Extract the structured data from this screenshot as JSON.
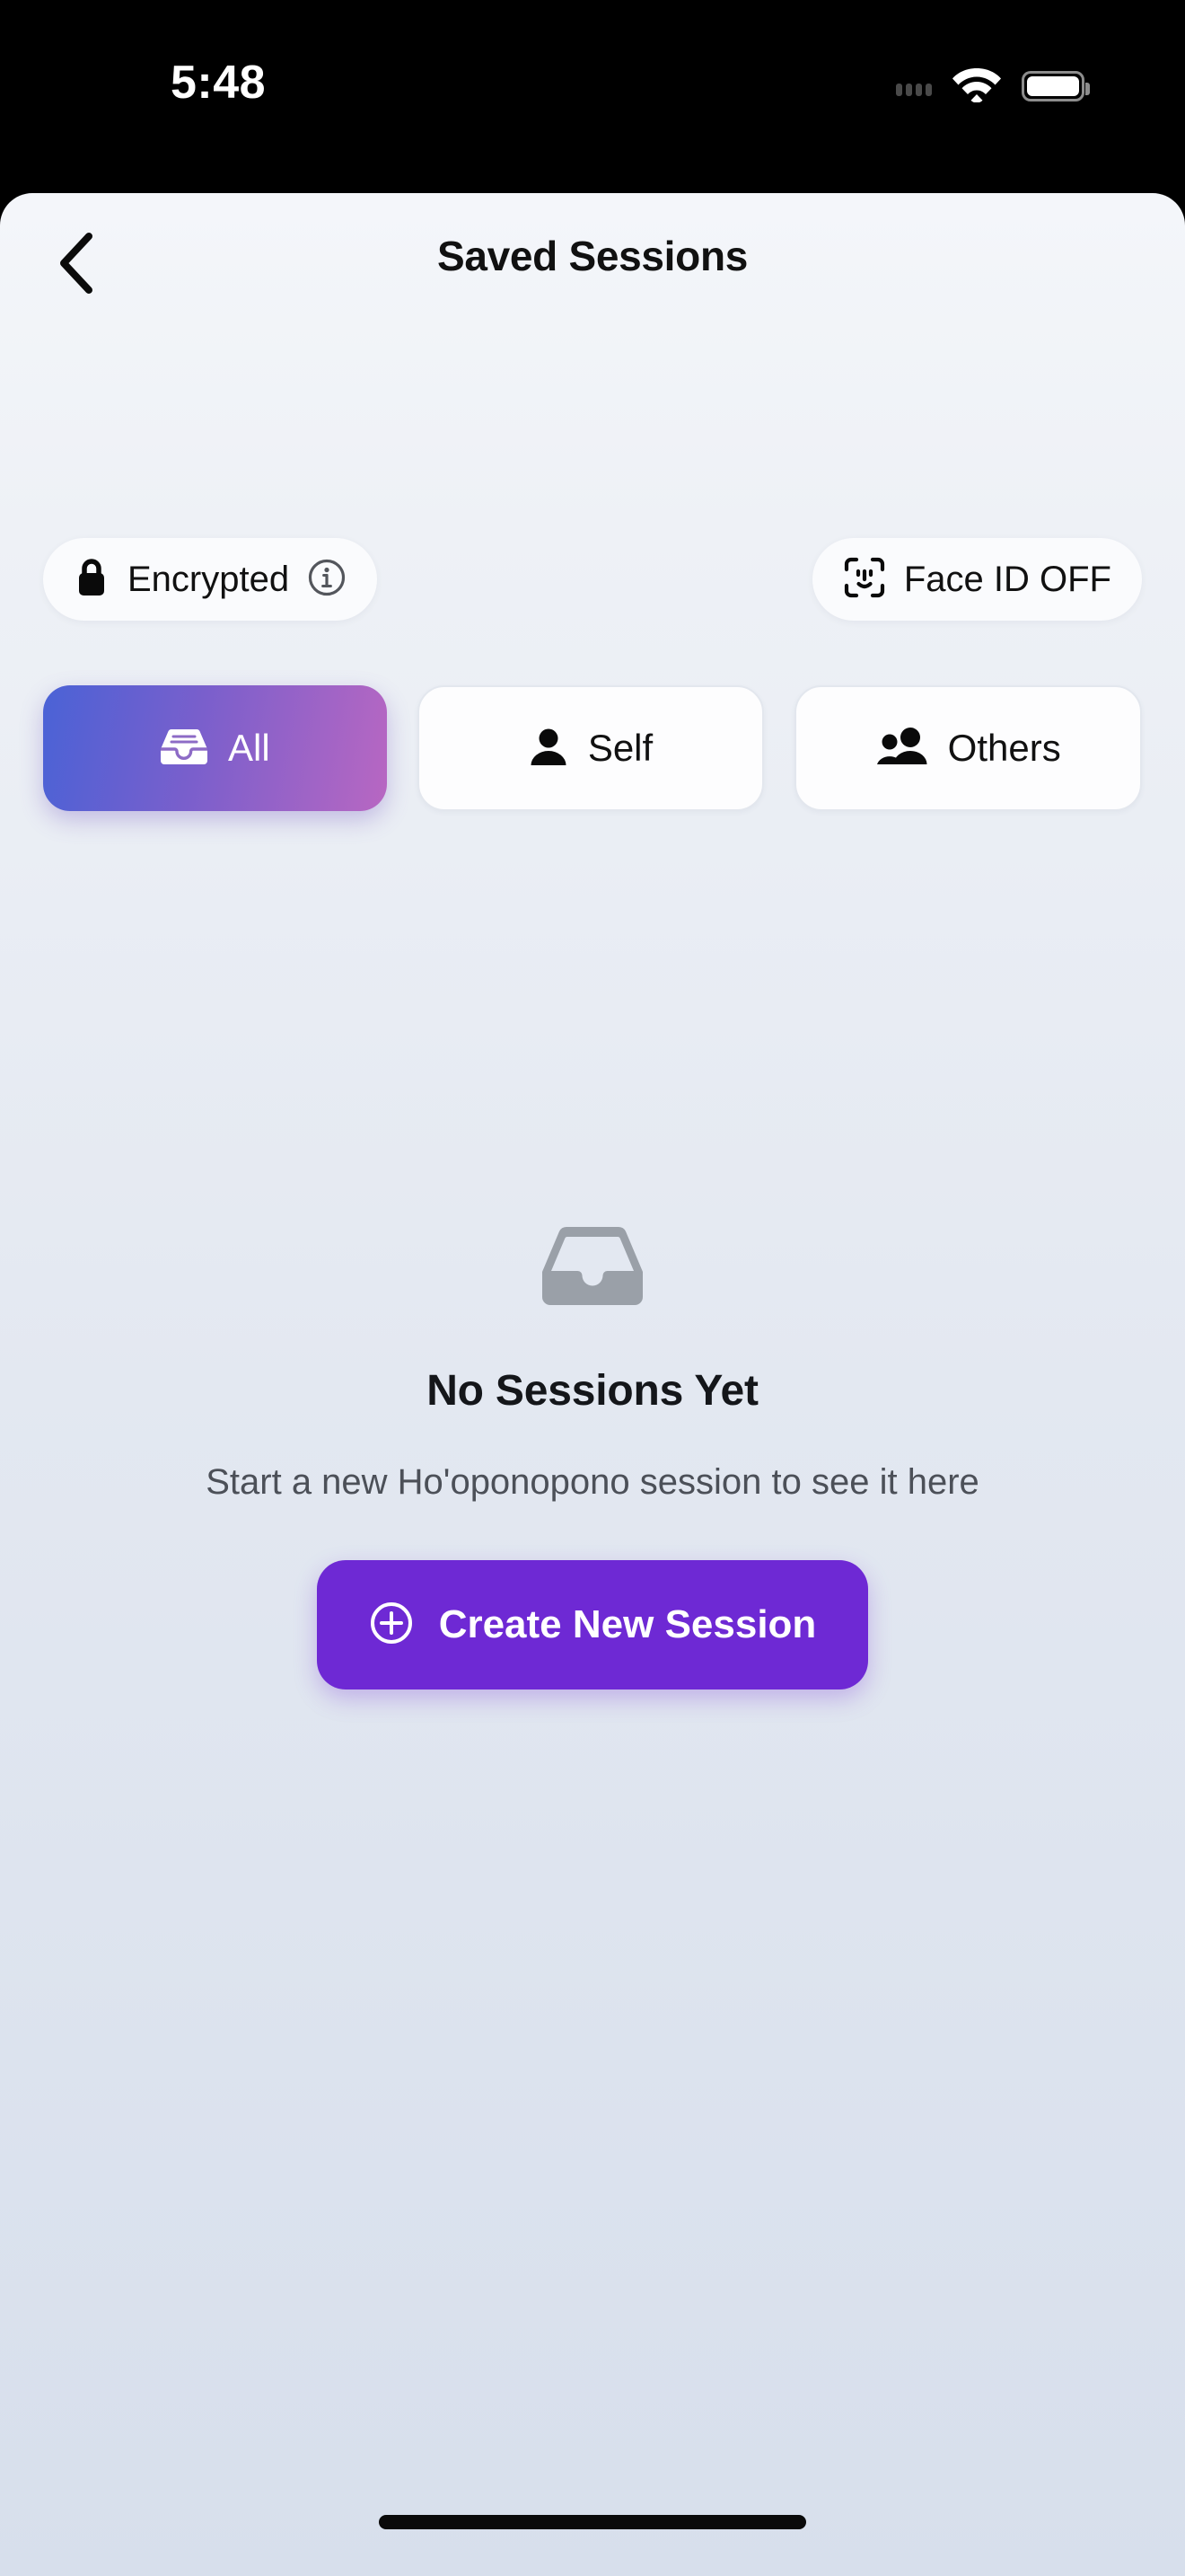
{
  "statusbar": {
    "time": "5:48",
    "signal_icon": "signal-dots-icon",
    "wifi_icon": "wifi-icon",
    "battery_icon": "battery-icon"
  },
  "navbar": {
    "back_icon": "chevron-left-icon",
    "title": "Saved Sessions"
  },
  "badges": {
    "encrypted": {
      "lock_icon": "lock-icon",
      "label": "Encrypted",
      "info_icon": "info-circle-icon"
    },
    "faceid": {
      "faceid_icon": "faceid-icon",
      "label": "Face ID OFF"
    }
  },
  "tabs": [
    {
      "label": "All",
      "icon": "inbox-icon",
      "active": true
    },
    {
      "label": "Self",
      "icon": "person-icon",
      "active": false
    },
    {
      "label": "Others",
      "icon": "people-icon",
      "active": false
    }
  ],
  "empty_state": {
    "icon": "inbox-empty-icon",
    "title": "No Sessions Yet",
    "subtitle": "Start a new Ho'oponopono session to see it here",
    "cta_icon": "plus-circle-icon",
    "cta_label": "Create New Session"
  },
  "colors": {
    "accent_purple": "#6e29d4",
    "gradient_start": "#4a62d6",
    "gradient_end": "#b867c2",
    "empty_icon_gray": "#9aa0a8",
    "panel_top": "#f4f6fa",
    "panel_bottom": "#d7dfec"
  }
}
